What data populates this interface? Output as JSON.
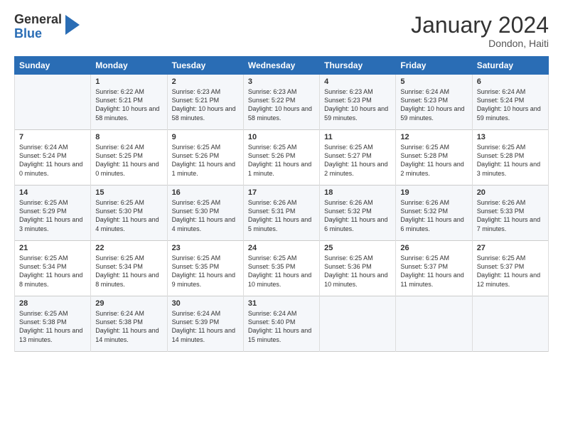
{
  "logo": {
    "general": "General",
    "blue": "Blue"
  },
  "header": {
    "month": "January 2024",
    "location": "Dondon, Haiti"
  },
  "days_of_week": [
    "Sunday",
    "Monday",
    "Tuesday",
    "Wednesday",
    "Thursday",
    "Friday",
    "Saturday"
  ],
  "weeks": [
    [
      {
        "day": "",
        "sunrise": "",
        "sunset": "",
        "daylight": ""
      },
      {
        "day": "1",
        "sunrise": "Sunrise: 6:22 AM",
        "sunset": "Sunset: 5:21 PM",
        "daylight": "Daylight: 10 hours and 58 minutes."
      },
      {
        "day": "2",
        "sunrise": "Sunrise: 6:23 AM",
        "sunset": "Sunset: 5:21 PM",
        "daylight": "Daylight: 10 hours and 58 minutes."
      },
      {
        "day": "3",
        "sunrise": "Sunrise: 6:23 AM",
        "sunset": "Sunset: 5:22 PM",
        "daylight": "Daylight: 10 hours and 58 minutes."
      },
      {
        "day": "4",
        "sunrise": "Sunrise: 6:23 AM",
        "sunset": "Sunset: 5:23 PM",
        "daylight": "Daylight: 10 hours and 59 minutes."
      },
      {
        "day": "5",
        "sunrise": "Sunrise: 6:24 AM",
        "sunset": "Sunset: 5:23 PM",
        "daylight": "Daylight: 10 hours and 59 minutes."
      },
      {
        "day": "6",
        "sunrise": "Sunrise: 6:24 AM",
        "sunset": "Sunset: 5:24 PM",
        "daylight": "Daylight: 10 hours and 59 minutes."
      }
    ],
    [
      {
        "day": "7",
        "sunrise": "Sunrise: 6:24 AM",
        "sunset": "Sunset: 5:24 PM",
        "daylight": "Daylight: 11 hours and 0 minutes."
      },
      {
        "day": "8",
        "sunrise": "Sunrise: 6:24 AM",
        "sunset": "Sunset: 5:25 PM",
        "daylight": "Daylight: 11 hours and 0 minutes."
      },
      {
        "day": "9",
        "sunrise": "Sunrise: 6:25 AM",
        "sunset": "Sunset: 5:26 PM",
        "daylight": "Daylight: 11 hours and 1 minute."
      },
      {
        "day": "10",
        "sunrise": "Sunrise: 6:25 AM",
        "sunset": "Sunset: 5:26 PM",
        "daylight": "Daylight: 11 hours and 1 minute."
      },
      {
        "day": "11",
        "sunrise": "Sunrise: 6:25 AM",
        "sunset": "Sunset: 5:27 PM",
        "daylight": "Daylight: 11 hours and 2 minutes."
      },
      {
        "day": "12",
        "sunrise": "Sunrise: 6:25 AM",
        "sunset": "Sunset: 5:28 PM",
        "daylight": "Daylight: 11 hours and 2 minutes."
      },
      {
        "day": "13",
        "sunrise": "Sunrise: 6:25 AM",
        "sunset": "Sunset: 5:28 PM",
        "daylight": "Daylight: 11 hours and 3 minutes."
      }
    ],
    [
      {
        "day": "14",
        "sunrise": "Sunrise: 6:25 AM",
        "sunset": "Sunset: 5:29 PM",
        "daylight": "Daylight: 11 hours and 3 minutes."
      },
      {
        "day": "15",
        "sunrise": "Sunrise: 6:25 AM",
        "sunset": "Sunset: 5:30 PM",
        "daylight": "Daylight: 11 hours and 4 minutes."
      },
      {
        "day": "16",
        "sunrise": "Sunrise: 6:25 AM",
        "sunset": "Sunset: 5:30 PM",
        "daylight": "Daylight: 11 hours and 4 minutes."
      },
      {
        "day": "17",
        "sunrise": "Sunrise: 6:26 AM",
        "sunset": "Sunset: 5:31 PM",
        "daylight": "Daylight: 11 hours and 5 minutes."
      },
      {
        "day": "18",
        "sunrise": "Sunrise: 6:26 AM",
        "sunset": "Sunset: 5:32 PM",
        "daylight": "Daylight: 11 hours and 6 minutes."
      },
      {
        "day": "19",
        "sunrise": "Sunrise: 6:26 AM",
        "sunset": "Sunset: 5:32 PM",
        "daylight": "Daylight: 11 hours and 6 minutes."
      },
      {
        "day": "20",
        "sunrise": "Sunrise: 6:26 AM",
        "sunset": "Sunset: 5:33 PM",
        "daylight": "Daylight: 11 hours and 7 minutes."
      }
    ],
    [
      {
        "day": "21",
        "sunrise": "Sunrise: 6:25 AM",
        "sunset": "Sunset: 5:34 PM",
        "daylight": "Daylight: 11 hours and 8 minutes."
      },
      {
        "day": "22",
        "sunrise": "Sunrise: 6:25 AM",
        "sunset": "Sunset: 5:34 PM",
        "daylight": "Daylight: 11 hours and 8 minutes."
      },
      {
        "day": "23",
        "sunrise": "Sunrise: 6:25 AM",
        "sunset": "Sunset: 5:35 PM",
        "daylight": "Daylight: 11 hours and 9 minutes."
      },
      {
        "day": "24",
        "sunrise": "Sunrise: 6:25 AM",
        "sunset": "Sunset: 5:35 PM",
        "daylight": "Daylight: 11 hours and 10 minutes."
      },
      {
        "day": "25",
        "sunrise": "Sunrise: 6:25 AM",
        "sunset": "Sunset: 5:36 PM",
        "daylight": "Daylight: 11 hours and 10 minutes."
      },
      {
        "day": "26",
        "sunrise": "Sunrise: 6:25 AM",
        "sunset": "Sunset: 5:37 PM",
        "daylight": "Daylight: 11 hours and 11 minutes."
      },
      {
        "day": "27",
        "sunrise": "Sunrise: 6:25 AM",
        "sunset": "Sunset: 5:37 PM",
        "daylight": "Daylight: 11 hours and 12 minutes."
      }
    ],
    [
      {
        "day": "28",
        "sunrise": "Sunrise: 6:25 AM",
        "sunset": "Sunset: 5:38 PM",
        "daylight": "Daylight: 11 hours and 13 minutes."
      },
      {
        "day": "29",
        "sunrise": "Sunrise: 6:24 AM",
        "sunset": "Sunset: 5:38 PM",
        "daylight": "Daylight: 11 hours and 14 minutes."
      },
      {
        "day": "30",
        "sunrise": "Sunrise: 6:24 AM",
        "sunset": "Sunset: 5:39 PM",
        "daylight": "Daylight: 11 hours and 14 minutes."
      },
      {
        "day": "31",
        "sunrise": "Sunrise: 6:24 AM",
        "sunset": "Sunset: 5:40 PM",
        "daylight": "Daylight: 11 hours and 15 minutes."
      },
      {
        "day": "",
        "sunrise": "",
        "sunset": "",
        "daylight": ""
      },
      {
        "day": "",
        "sunrise": "",
        "sunset": "",
        "daylight": ""
      },
      {
        "day": "",
        "sunrise": "",
        "sunset": "",
        "daylight": ""
      }
    ]
  ]
}
